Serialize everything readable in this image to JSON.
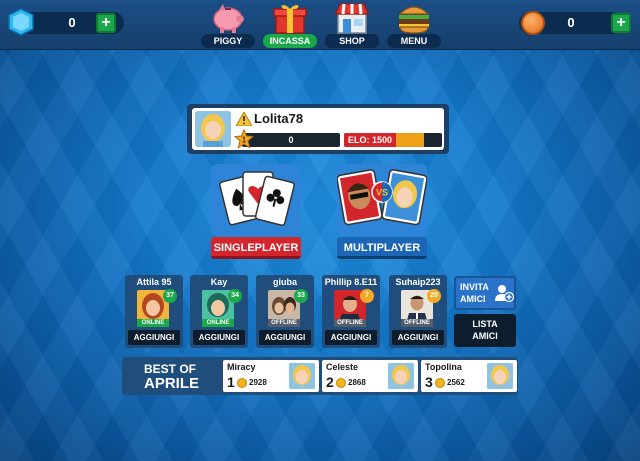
{
  "topbar": {
    "gems": "0",
    "coins": "0",
    "plus_label": "+",
    "nav": [
      {
        "label": "PIGGY",
        "icon": "piggy-bank-icon"
      },
      {
        "label": "INCASSA",
        "icon": "gift-box-icon"
      },
      {
        "label": "SHOP",
        "icon": "shop-icon"
      },
      {
        "label": "MENU",
        "icon": "burger-menu-icon"
      }
    ]
  },
  "profile": {
    "username": "Lolita78",
    "level": "1",
    "xp": "0",
    "elo_label": "ELO: 1500",
    "elo_progress": 0.82
  },
  "modes": {
    "single": "SINGLEPLAYER",
    "multi": "MULTIPLAYER",
    "vs": "VS"
  },
  "friends": [
    {
      "name": "Attila 95",
      "level": "37",
      "status": "ONLINE",
      "button": "AGGIUNGI",
      "status_color": "#1aa84a"
    },
    {
      "name": "Kay",
      "level": "34",
      "status": "ONLINE",
      "button": "AGGIUNGI",
      "status_color": "#1aa84a"
    },
    {
      "name": "giuba",
      "level": "33",
      "status": "OFFLINE",
      "button": "AGGIUNGI",
      "status_color": "#555f6b"
    },
    {
      "name": "Phillip 8.E11",
      "level": "7",
      "status": "OFFLINE",
      "button": "AGGIUNGI",
      "status_color": "#555f6b"
    },
    {
      "name": "Suhaip223",
      "level": "20",
      "status": "OFFLINE",
      "button": "AGGIUNGI",
      "status_color": "#555f6b"
    }
  ],
  "invite": {
    "line1": "INVITA",
    "line2": "AMICI"
  },
  "list": {
    "line1": "LISTA",
    "line2": "AMICI"
  },
  "best": {
    "title1": "BEST OF",
    "title2": "APRILE",
    "ranks": [
      {
        "name": "Miracy",
        "pos": "1",
        "score": "2928"
      },
      {
        "name": "Celeste",
        "pos": "2",
        "score": "2868"
      },
      {
        "name": "Topolina",
        "pos": "3",
        "score": "2562"
      }
    ]
  },
  "colors": {
    "accent_red": "#d3262c",
    "accent_blue": "#1b67b5",
    "green": "#1aa84a",
    "panel": "#1f4d7c"
  }
}
